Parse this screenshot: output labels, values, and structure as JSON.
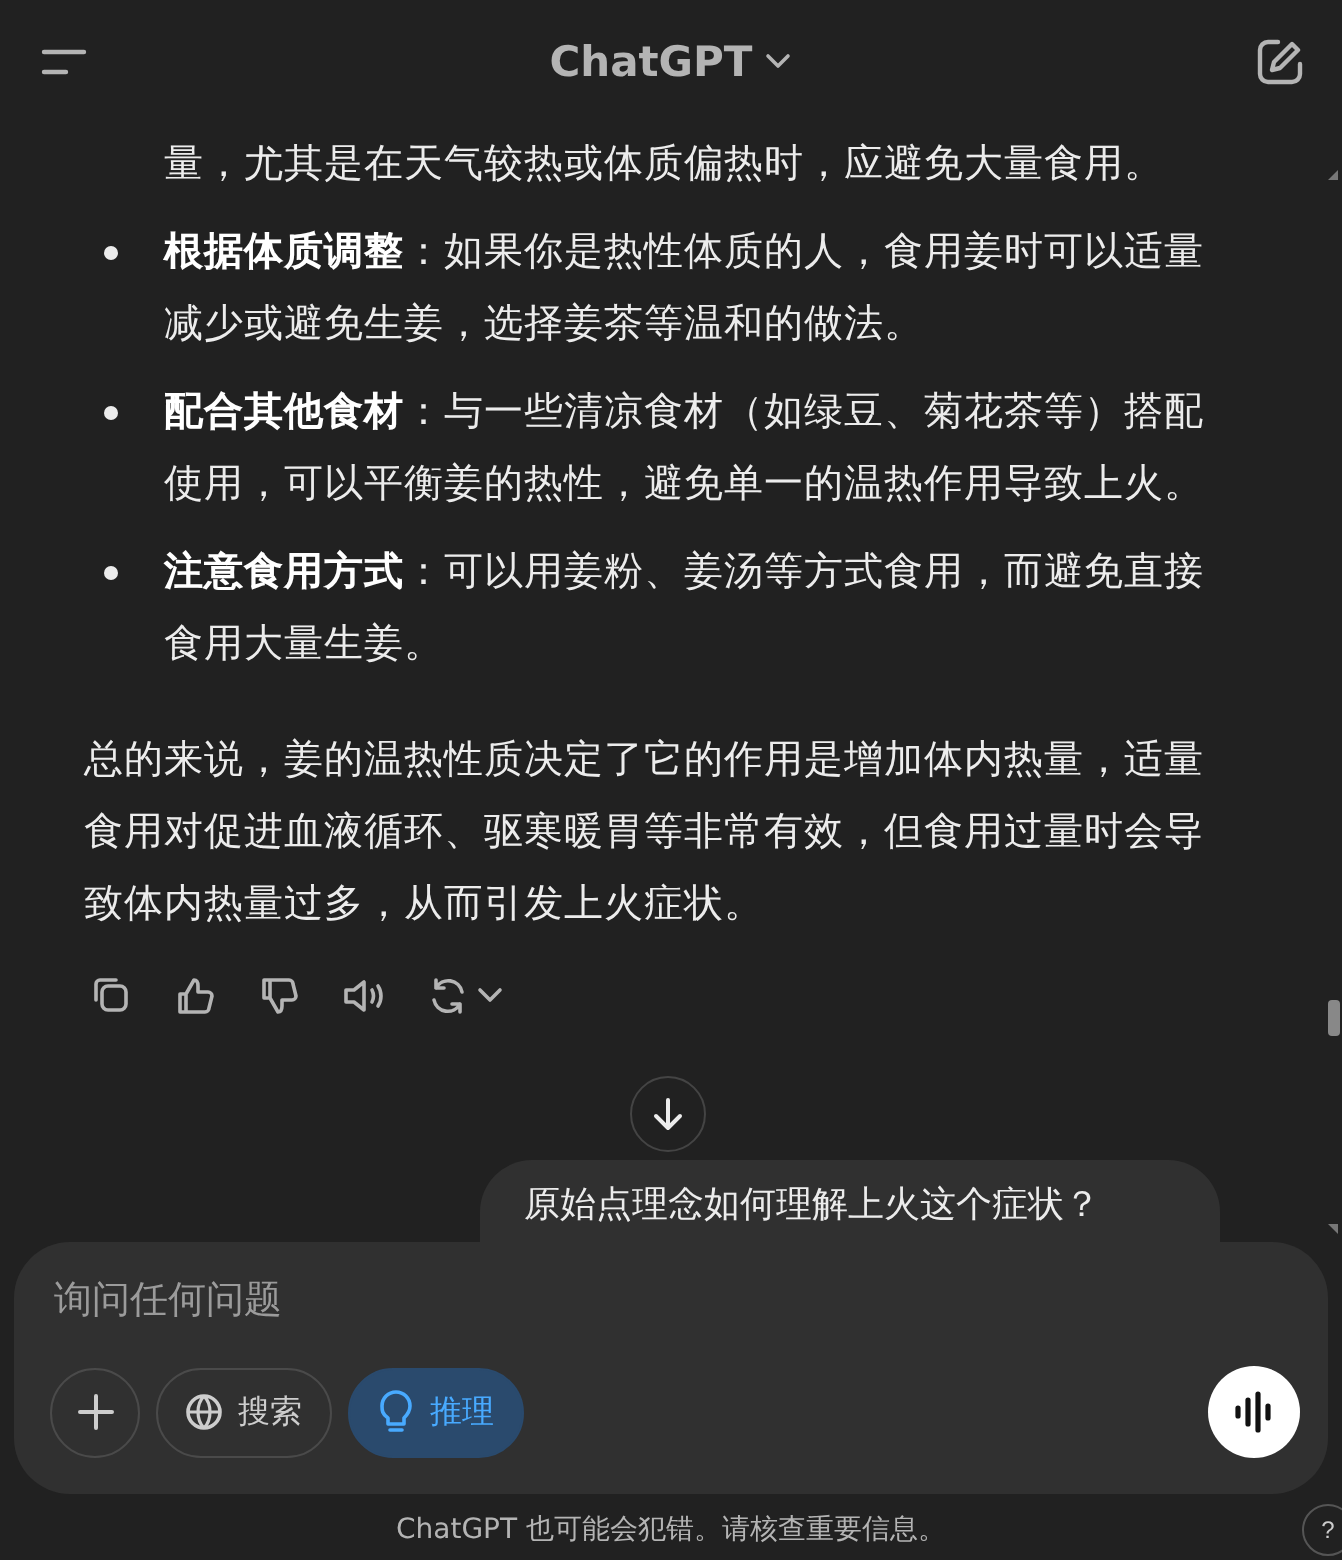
{
  "header": {
    "title": "ChatGPT"
  },
  "answer": {
    "continued_line": "量，尤其是在天气较热或体质偏热时，应避免大量食用。",
    "bullets": [
      {
        "term": "根据体质调整",
        "text": "：如果你是热性体质的人，食用姜时可以适量减少或避免生姜，选择姜茶等温和的做法。"
      },
      {
        "term": "配合其他食材",
        "text": "：与一些清凉食材（如绿豆、菊花茶等）搭配使用，可以平衡姜的热性，避免单一的温热作用导致上火。"
      },
      {
        "term": "注意食用方式",
        "text": "：可以用姜粉、姜汤等方式食用，而避免直接食用大量生姜。"
      }
    ],
    "summary": "总的来说，姜的温热性质决定了它的作用是增加体内热量，适量食用对促进血液循环、驱寒暖胃等非常有效，但食用过量时会导致体内热量过多，从而引发上火症状。"
  },
  "user_message": "原始点理念如何理解上火这个症状？",
  "composer": {
    "placeholder": "询问任何问题",
    "tools": [
      {
        "kind": "globe",
        "label": "搜索",
        "selected": false
      },
      {
        "kind": "bulb",
        "label": "推理",
        "selected": true
      }
    ]
  },
  "disclaimer": "ChatGPT 也可能会犯错。请核查重要信息。",
  "help": "?"
}
